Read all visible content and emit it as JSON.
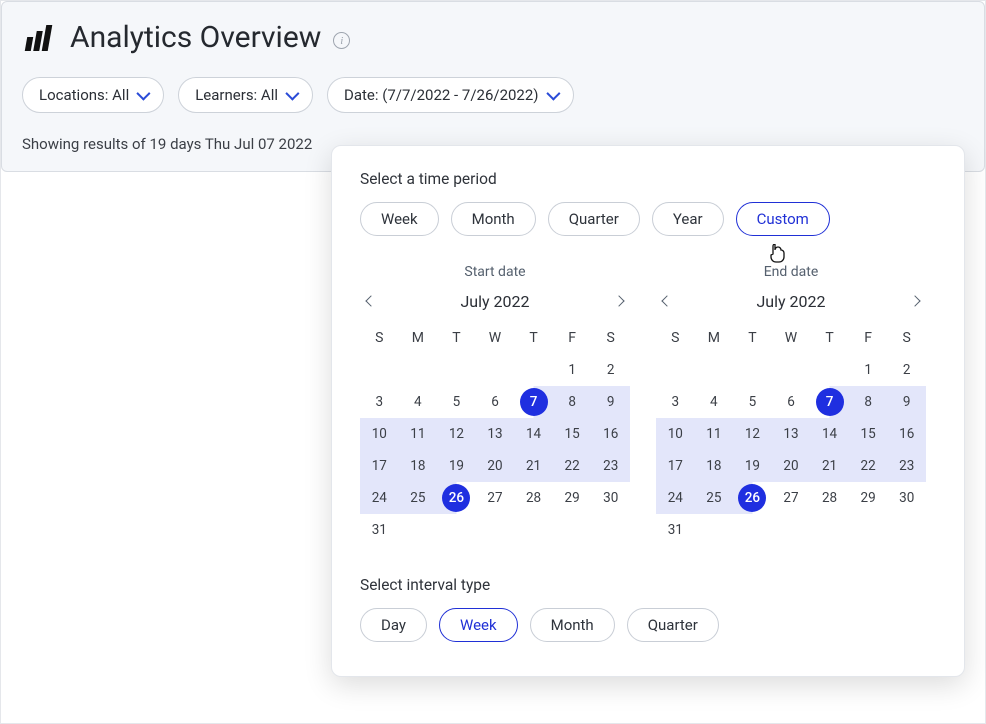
{
  "header": {
    "title": "Analytics Overview"
  },
  "filters": {
    "locations": "Locations: All",
    "learners": "Learners: All",
    "date": "Date: (7/7/2022 - 7/26/2022)"
  },
  "results_text": "Showing results of 19 days Thu Jul 07 2022",
  "popover": {
    "select_period_label": "Select a time period",
    "periods": {
      "week": "Week",
      "month": "Month",
      "quarter": "Quarter",
      "year": "Year",
      "custom": "Custom"
    },
    "active_period": "custom",
    "start_label": "Start date",
    "end_label": "End date",
    "month_label": "July 2022",
    "dow": [
      "S",
      "M",
      "T",
      "W",
      "T",
      "F",
      "S"
    ],
    "weeks": [
      [
        "",
        "",
        "",
        "",
        "",
        "1",
        "2"
      ],
      [
        "3",
        "4",
        "5",
        "6",
        "7",
        "8",
        "9"
      ],
      [
        "10",
        "11",
        "12",
        "13",
        "14",
        "15",
        "16"
      ],
      [
        "17",
        "18",
        "19",
        "20",
        "21",
        "22",
        "23"
      ],
      [
        "24",
        "25",
        "26",
        "27",
        "28",
        "29",
        "30"
      ],
      [
        "31",
        "",
        "",
        "",
        "",
        "",
        ""
      ]
    ],
    "range_start_day": "7",
    "range_end_day": "26",
    "select_interval_label": "Select interval type",
    "intervals": {
      "day": "Day",
      "week": "Week",
      "month": "Month",
      "quarter": "Quarter"
    },
    "active_interval": "week"
  }
}
